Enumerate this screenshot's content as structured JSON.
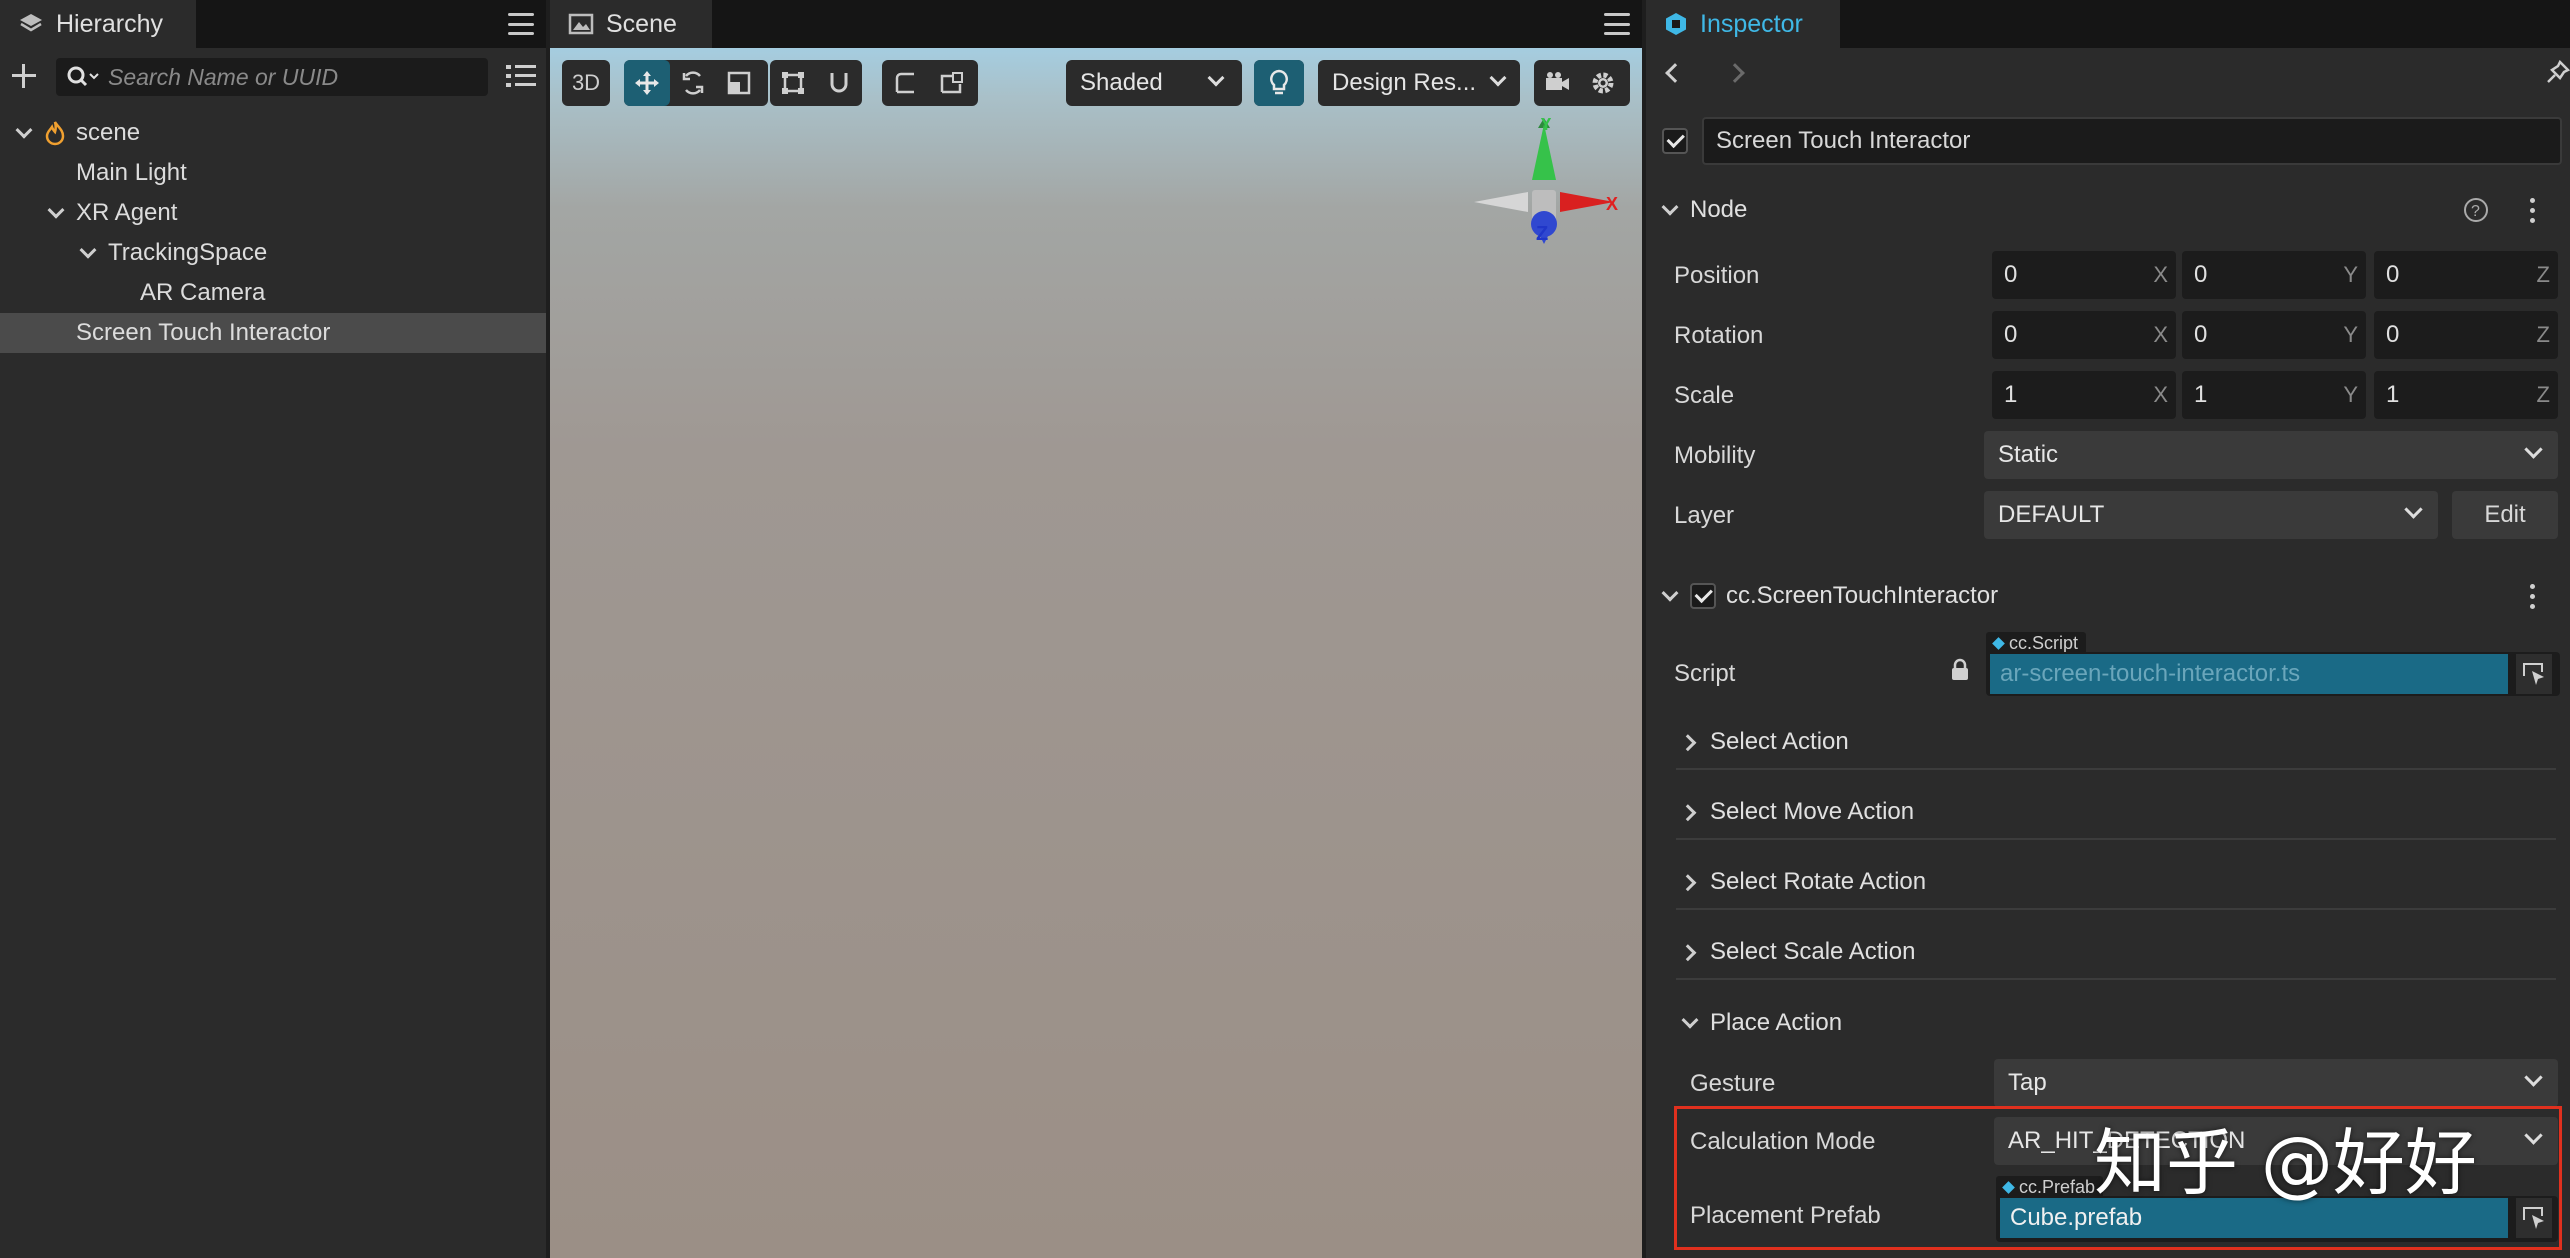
{
  "hierarchy": {
    "tab_label": "Hierarchy",
    "search_placeholder": "Search Name or UUID",
    "nodes": [
      {
        "label": "scene"
      },
      {
        "label": "Main Light"
      },
      {
        "label": "XR Agent"
      },
      {
        "label": "TrackingSpace"
      },
      {
        "label": "AR Camera"
      },
      {
        "label": "Screen Touch Interactor"
      }
    ]
  },
  "scene": {
    "tab_label": "Scene",
    "mode_label": "3D",
    "shading": "Shaded",
    "design_res": "Design Res...",
    "gizmo": {
      "x": "X",
      "y": "Y",
      "z": "Z"
    }
  },
  "inspector": {
    "tab_label": "Inspector",
    "node_name": "Screen Touch Interactor",
    "node_section": "Node",
    "position_label": "Position",
    "position": [
      "0",
      "0",
      "0"
    ],
    "rotation_label": "Rotation",
    "rotation": [
      "0",
      "0",
      "0"
    ],
    "scale_label": "Scale",
    "scale": [
      "1",
      "1",
      "1"
    ],
    "axes": [
      "X",
      "Y",
      "Z"
    ],
    "mobility_label": "Mobility",
    "mobility_value": "Static",
    "layer_label": "Layer",
    "layer_value": "DEFAULT",
    "edit_label": "Edit",
    "component_name": "cc.ScreenTouchInteractor",
    "script_label": "Script",
    "script_tag": "cc.Script",
    "script_value": "ar-screen-touch-interactor.ts",
    "actions": [
      "Select Action",
      "Select Move Action",
      "Select Rotate Action",
      "Select Scale Action",
      "Place Action"
    ],
    "gesture_label": "Gesture",
    "gesture_value": "Tap",
    "calc_mode_label": "Calculation Mode",
    "calc_mode_value": "AR_HIT_DETECTION",
    "prefab_label": "Placement Prefab",
    "prefab_tag": "cc.Prefab",
    "prefab_value": "Cube.prefab",
    "highlight_color": "#e0301e"
  },
  "watermark": "知乎 @好好"
}
